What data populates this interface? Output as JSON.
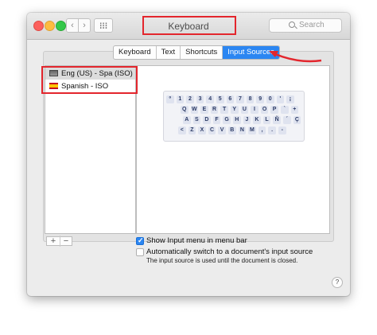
{
  "window": {
    "title": "Keyboard",
    "search_placeholder": "Search"
  },
  "toolbar": {
    "back_glyph": "‹",
    "forward_glyph": "›"
  },
  "tabs": [
    {
      "label": "Keyboard",
      "active": false
    },
    {
      "label": "Text",
      "active": false
    },
    {
      "label": "Shortcuts",
      "active": false
    },
    {
      "label": "Input Sources",
      "active": true
    }
  ],
  "input_sources": [
    {
      "label": "Eng (US) - Spa (ISO)",
      "flag": "us-flag-icon",
      "selected": true
    },
    {
      "label": "Spanish - ISO",
      "flag": "spain-flag-icon",
      "selected": false
    }
  ],
  "keyboard_preview": {
    "rows": [
      [
        "º",
        "1",
        "2",
        "3",
        "4",
        "5",
        "6",
        "7",
        "8",
        "9",
        "0",
        "'",
        "¡"
      ],
      [
        "Q",
        "W",
        "E",
        "R",
        "T",
        "Y",
        "U",
        "I",
        "O",
        "P",
        "`",
        "+"
      ],
      [
        "A",
        "S",
        "D",
        "F",
        "G",
        "H",
        "J",
        "K",
        "L",
        "Ñ",
        "´",
        "Ç"
      ],
      [
        "<",
        "Z",
        "X",
        "C",
        "V",
        "B",
        "N",
        "M",
        ",",
        ".",
        "-"
      ]
    ]
  },
  "list_controls": {
    "add": "+",
    "remove": "−"
  },
  "options": {
    "show_menu": {
      "label": "Show Input menu in menu bar",
      "checked": true
    },
    "auto_switch": {
      "label": "Automatically switch to a document's input source",
      "checked": false
    },
    "note": "The input source is used until the document is closed."
  },
  "help": "?",
  "annotation": {
    "color": "#e3262d"
  },
  "colors": {
    "accent": "#2b86f2"
  }
}
